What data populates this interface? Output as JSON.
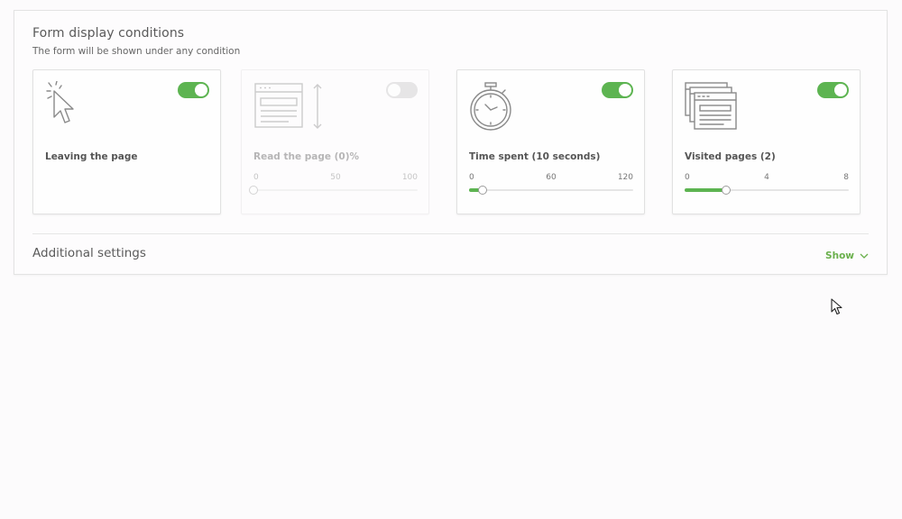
{
  "header": {
    "title": "Form display conditions",
    "subtitle": "The form will be shown under any condition"
  },
  "cards": [
    {
      "label": "Leaving the page",
      "enabled": true,
      "icon": "cursor-click-icon"
    },
    {
      "label": "Read the page (0)%",
      "enabled": false,
      "icon": "page-scroll-icon",
      "slider": {
        "min": "0",
        "mid": "50",
        "max": "100",
        "value": 0
      }
    },
    {
      "label": "Time spent (10 seconds)",
      "enabled": true,
      "icon": "stopwatch-icon",
      "slider": {
        "min": "0",
        "mid": "60",
        "max": "120",
        "value": 10
      }
    },
    {
      "label": "Visited pages (2)",
      "enabled": true,
      "icon": "stacked-windows-icon",
      "slider": {
        "min": "0",
        "mid": "4",
        "max": "8",
        "value": 2
      }
    }
  ],
  "additional": {
    "title": "Additional settings",
    "show_label": "Show"
  },
  "colors": {
    "accent": "#5db451",
    "toggle_off": "#c7c7c7"
  }
}
